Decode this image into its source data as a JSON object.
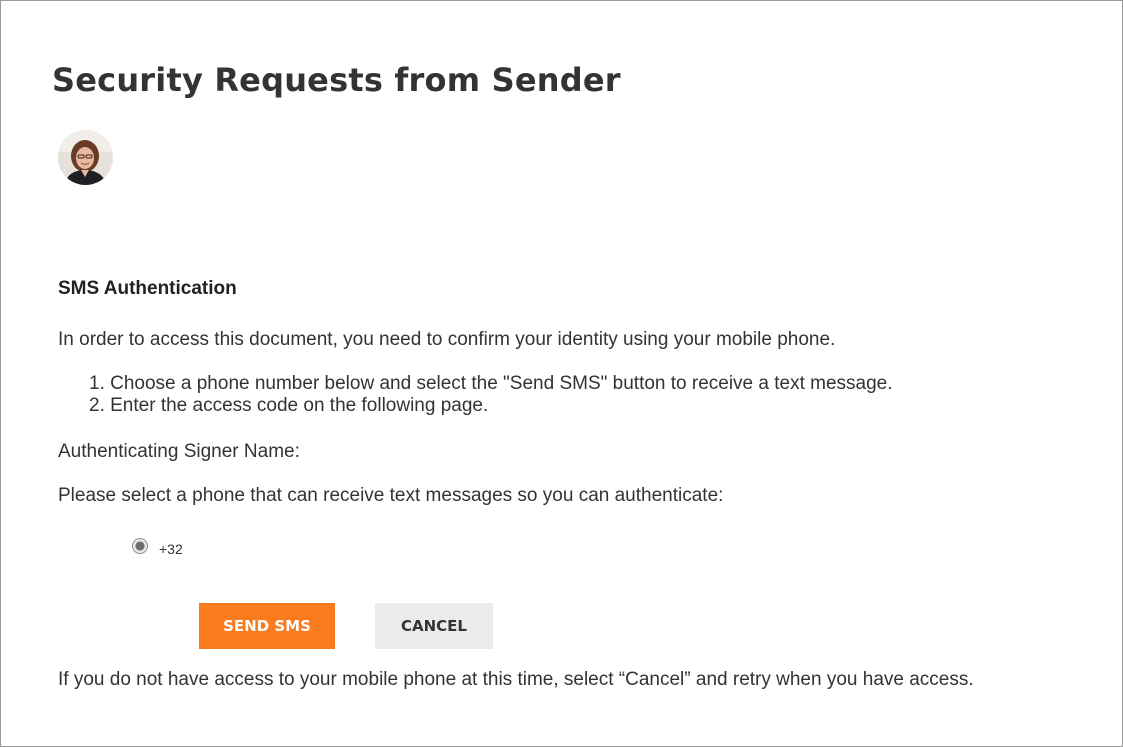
{
  "page": {
    "title": "Security Requests from Sender"
  },
  "sms_auth": {
    "heading": "SMS Authentication",
    "intro": "In order to access this document, you need to confirm your identity using your mobile phone.",
    "steps": [
      "1. Choose a phone number below and select the \"Send SMS\" button to receive a text message.",
      "2. Enter the access code on the following page."
    ],
    "signer_label": "Authenticating Signer Name:",
    "select_phone_prompt": "Please select a phone that can receive text messages so you can authenticate:",
    "phone_options": [
      {
        "number": "+32",
        "selected": true
      }
    ],
    "send_button_label": "SEND SMS",
    "cancel_button_label": "CANCEL",
    "footer_note": "If you do not have access to your mobile phone at this time, select “Cancel” and retry when you have access."
  },
  "colors": {
    "primary_button": "#f97b1d",
    "secondary_button": "#ebebeb",
    "text": "#333333"
  },
  "icons": {
    "avatar": "sender-avatar-photo",
    "radio": "radio-selected-icon"
  }
}
